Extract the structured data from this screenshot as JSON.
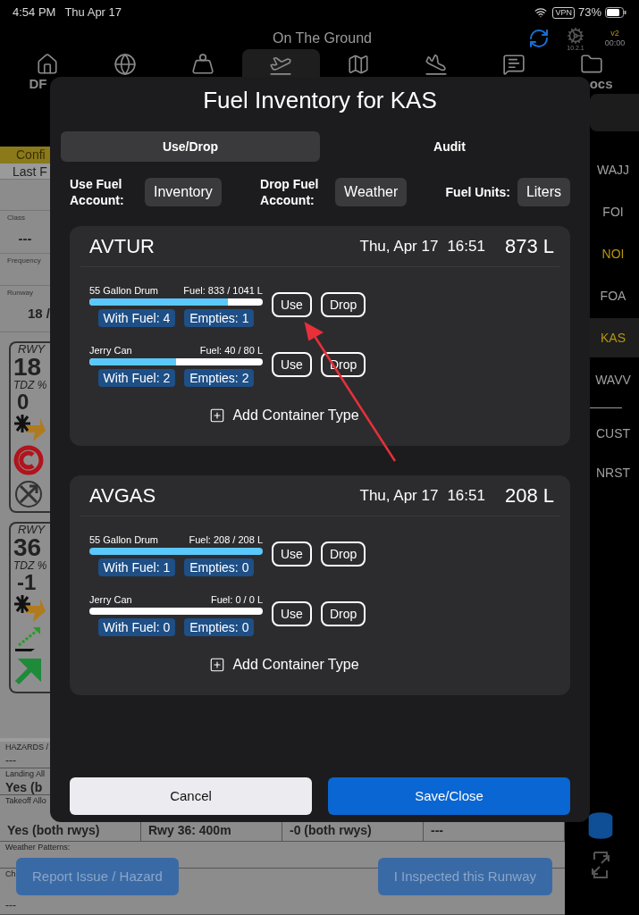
{
  "status_bar": {
    "time": "4:54 PM",
    "date": "Thu Apr 17",
    "vpn": "VPN",
    "battery": "73%"
  },
  "header": {
    "title": "On The Ground",
    "app_version": "10.2.1",
    "version": "v2",
    "timer": "00:00"
  },
  "nav_tabs": [
    {
      "kind": "home",
      "label": "DF",
      "selected": false
    },
    {
      "kind": "globe",
      "selected": false
    },
    {
      "kind": "weight",
      "selected": false
    },
    {
      "kind": "takeoff",
      "selected": true
    },
    {
      "kind": "map",
      "selected": false
    },
    {
      "kind": "landing",
      "selected": false
    },
    {
      "kind": "message",
      "selected": false
    },
    {
      "kind": "folder",
      "label": "ocs",
      "selected": false
    }
  ],
  "left_panel": {
    "banner": "Confi",
    "last": "Last F",
    "fields": [
      {
        "label": "Class",
        "value": "---"
      },
      {
        "label": "Frequency"
      },
      {
        "label": "Runway",
        "value": "18 /"
      }
    ],
    "runway_cards": [
      {
        "rwy": "RWY",
        "number": "18",
        "tdz": "TDZ %",
        "value": "0",
        "signs": [
          {
            "kind": "wind"
          },
          {
            "kind": "closed"
          },
          {
            "kind": "blocked"
          }
        ]
      },
      {
        "rwy": "RWY",
        "number": "36",
        "tdz": "TDZ %",
        "value": "-1",
        "signs": [
          {
            "kind": "wind"
          },
          {
            "kind": "slope"
          },
          {
            "kind": "go"
          }
        ]
      }
    ]
  },
  "info_table": {
    "rows": [
      {
        "label": "HAZARDS /",
        "value": "---"
      },
      {
        "label": "Landing All",
        "value": "Yes (b"
      },
      {
        "label": "Takeoff Allo",
        "cells": [
          "Yes (both rwys)",
          "Rwy 36: 400m",
          "-0 (both rwys)",
          "---"
        ]
      },
      {
        "label": "Weather Patterns:"
      },
      {
        "label": "Ch",
        "value": "---"
      }
    ],
    "buttons": [
      "Report Issue / Hazard",
      "I Inspected this Runway"
    ]
  },
  "sidebar": {
    "airports": [
      {
        "label": "WAJJ",
        "selected": false,
        "color": "#a0a0a0"
      },
      {
        "label": "FOI",
        "selected": false,
        "color": "#a0a0a0"
      },
      {
        "label": "NOI",
        "selected": false,
        "color": "#b8950e"
      },
      {
        "label": "FOA",
        "selected": false,
        "color": "#a0a0a0"
      },
      {
        "label": "KAS",
        "selected": true,
        "color": "#b8950e"
      },
      {
        "label": "WAVV",
        "selected": false,
        "color": "#a0a0a0"
      }
    ],
    "lists": [
      {
        "label": "CUST"
      },
      {
        "label": "NRST"
      }
    ]
  },
  "modal": {
    "title": "Fuel Inventory for KAS",
    "tabs": [
      {
        "label": "Use/Drop",
        "selected": true
      },
      {
        "label": "Audit",
        "selected": false
      }
    ],
    "accounts": [
      {
        "label": "Use Fuel Account:",
        "value": "Inventory"
      },
      {
        "label": "Drop Fuel Account:",
        "value": "Weather"
      },
      {
        "label": "Fuel Units:",
        "value": "Liters"
      }
    ],
    "fuels": [
      {
        "name": "AVTUR",
        "date": "Thu, Apr 17",
        "time": "16:51",
        "total": "873 L",
        "add": "Add Container Type",
        "containers": [
          {
            "name": "55 Gallon Drum",
            "fuel": "Fuel: 833 / 1041 L",
            "level": 0.8,
            "with_fuel": "With Fuel: 4",
            "empties": "Empties: 1",
            "use": "Use",
            "drop": "Drop"
          },
          {
            "name": "Jerry Can",
            "fuel": "Fuel: 40 / 80 L",
            "level": 0.5,
            "with_fuel": "With Fuel: 2",
            "empties": "Empties: 2",
            "use": "Use",
            "drop": "Drop"
          }
        ]
      },
      {
        "name": "AVGAS",
        "date": "Thu, Apr 17",
        "time": "16:51",
        "total": "208 L",
        "add": "Add Container Type",
        "containers": [
          {
            "name": "55 Gallon Drum",
            "fuel": "Fuel: 208 / 208 L",
            "level": 1,
            "with_fuel": "With Fuel: 1",
            "empties": "Empties: 0",
            "use": "Use",
            "drop": "Drop"
          },
          {
            "name": "Jerry Can",
            "fuel": "Fuel: 0 / 0 L",
            "level": 0,
            "with_fuel": "With Fuel: 0",
            "empties": "Empties: 0",
            "use": "Use",
            "drop": "Drop"
          }
        ]
      }
    ],
    "buttons": [
      {
        "kind": "secondary",
        "label": "Cancel"
      },
      {
        "kind": "primary",
        "label": "Save/Close"
      }
    ]
  }
}
